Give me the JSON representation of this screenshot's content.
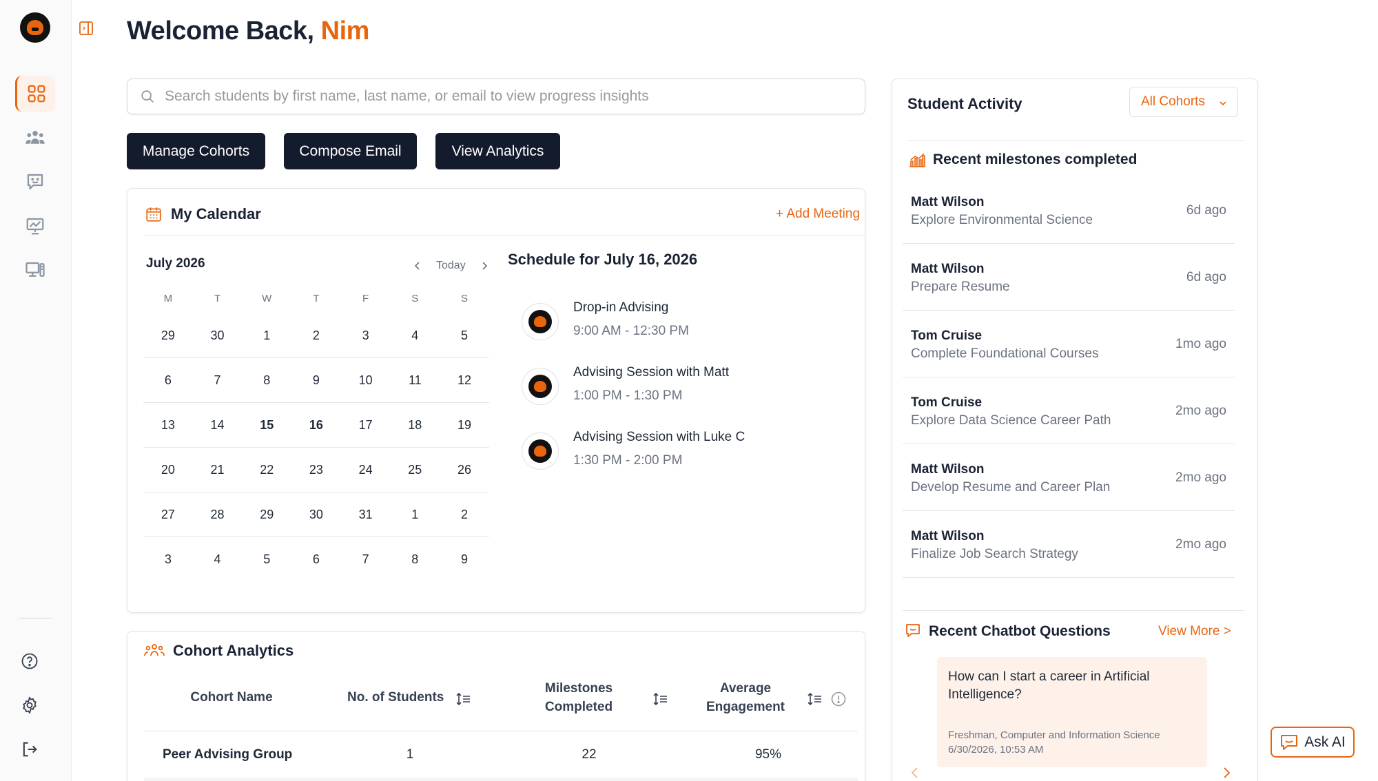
{
  "app": {
    "welcome_prefix": "Welcome Back,",
    "user_name": "Nim",
    "accent_color": "#e8650e",
    "dark_color": "#141b2d"
  },
  "sidebar": {
    "items": [
      {
        "name": "dashboard",
        "icon": "grid-icon",
        "active": true
      },
      {
        "name": "students",
        "icon": "group-icon",
        "active": false
      },
      {
        "name": "chat",
        "icon": "chat-icon",
        "active": false
      },
      {
        "name": "analytics",
        "icon": "presentation-chart-icon",
        "active": false
      },
      {
        "name": "devices",
        "icon": "desktop-icon",
        "active": false
      }
    ],
    "bottom": [
      {
        "name": "help",
        "icon": "help-icon"
      },
      {
        "name": "settings",
        "icon": "gear-icon"
      },
      {
        "name": "logout",
        "icon": "logout-icon"
      }
    ]
  },
  "search": {
    "placeholder": "Search students by first name, last name, or email to view progress insights",
    "value": ""
  },
  "actions": {
    "manage_cohorts": "Manage Cohorts",
    "compose_email": "Compose Email",
    "view_analytics": "View Analytics"
  },
  "calendar": {
    "title": "My Calendar",
    "add_meeting": "+ Add Meeting",
    "month_label": "July 2026",
    "today_label": "Today",
    "weekdays": [
      "M",
      "T",
      "W",
      "T",
      "F",
      "S",
      "S"
    ],
    "weeks": [
      [
        "29",
        "30",
        "1",
        "2",
        "3",
        "4",
        "5"
      ],
      [
        "6",
        "7",
        "8",
        "9",
        "10",
        "11",
        "12"
      ],
      [
        "13",
        "14",
        "15",
        "16",
        "17",
        "18",
        "19"
      ],
      [
        "20",
        "21",
        "22",
        "23",
        "24",
        "25",
        "26"
      ],
      [
        "27",
        "28",
        "29",
        "30",
        "31",
        "1",
        "2"
      ],
      [
        "3",
        "4",
        "5",
        "6",
        "7",
        "8",
        "9"
      ]
    ],
    "today_day": "15",
    "selected_day": "16",
    "schedule_title": "Schedule for July 16, 2026",
    "events": [
      {
        "name": "Drop-in Advising",
        "time": "9:00 AM - 12:30 PM"
      },
      {
        "name": "Advising Session with Matt",
        "time": "1:00 PM - 1:30 PM"
      },
      {
        "name": "Advising Session with Luke C",
        "time": "1:30 PM - 2:00 PM"
      }
    ]
  },
  "cohort_analytics": {
    "title": "Cohort Analytics",
    "columns": {
      "cohort_name": "Cohort Name",
      "students": "No. of Students",
      "milestones_1": "Milestones",
      "milestones_2": "Completed",
      "engagement_1": "Average",
      "engagement_2": "Engagement"
    },
    "rows": [
      {
        "name": "Peer Advising Group",
        "students": "1",
        "milestones": "22",
        "engagement": "95%"
      }
    ]
  },
  "student_activity": {
    "title": "Student Activity",
    "cohort_filter": "All Cohorts",
    "milestones_title": "Recent milestones completed",
    "milestones": [
      {
        "student": "Matt Wilson",
        "milestone": "Explore Environmental Science",
        "ago": "6d ago"
      },
      {
        "student": "Matt Wilson",
        "milestone": "Prepare Resume",
        "ago": "6d ago"
      },
      {
        "student": "Tom Cruise",
        "milestone": "Complete Foundational Courses",
        "ago": "1mo ago"
      },
      {
        "student": "Tom Cruise",
        "milestone": "Explore Data Science Career Path",
        "ago": "2mo ago"
      },
      {
        "student": "Matt Wilson",
        "milestone": "Develop Resume and Career Plan",
        "ago": "2mo ago"
      },
      {
        "student": "Matt Wilson",
        "milestone": "Finalize Job Search Strategy",
        "ago": "2mo ago"
      }
    ],
    "chatbot_title": "Recent Chatbot Questions",
    "view_more": "View More >",
    "chat_question": "How can I start a career in Artificial Intelligence?",
    "chat_meta_line1": "Freshman, Computer and Information Science",
    "chat_meta_line2": "6/30/2026, 10:53 AM"
  },
  "ask_ai": "Ask AI"
}
